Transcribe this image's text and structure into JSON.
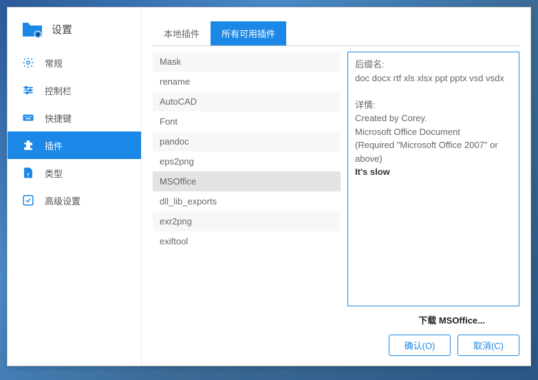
{
  "sidebar": {
    "title": "设置",
    "items": [
      {
        "label": "常规"
      },
      {
        "label": "控制栏"
      },
      {
        "label": "快捷键"
      },
      {
        "label": "插件"
      },
      {
        "label": "类型"
      },
      {
        "label": "高级设置"
      }
    ]
  },
  "tabs": [
    {
      "label": "本地插件"
    },
    {
      "label": "所有可用插件"
    }
  ],
  "plugins": [
    "Mask",
    "rename",
    "AutoCAD",
    "Font",
    "pandoc",
    "eps2png",
    "MSOffice",
    "dll_lib_exports",
    "exr2png",
    "exiftool"
  ],
  "detail": {
    "suffix_label": "后缀名:",
    "suffix": "doc docx rtf xls xlsx ppt pptx vsd vsdx",
    "info_label": "详情:",
    "created_by": "Created by Corey.",
    "desc1": "Microsoft Office Document",
    "desc2": "(Required \"Microsoft Office 2007\" or above)",
    "warn": "It's slow"
  },
  "download": "下载 MSOffice...",
  "buttons": {
    "ok": "确认(O)",
    "cancel": "取消(C)"
  }
}
